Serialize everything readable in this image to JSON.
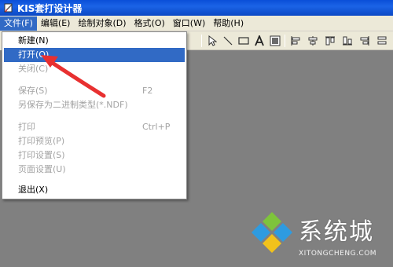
{
  "window": {
    "title": "KIS套打设计器"
  },
  "menubar": {
    "items": [
      {
        "label": "文件(F)"
      },
      {
        "label": "编辑(E)"
      },
      {
        "label": "绘制对象(D)"
      },
      {
        "label": "格式(O)"
      },
      {
        "label": "窗口(W)"
      },
      {
        "label": "帮助(H)"
      }
    ]
  },
  "file_menu": {
    "items": [
      {
        "label": "新建(N)",
        "shortcut": ""
      },
      {
        "label": "打开(O)",
        "shortcut": ""
      },
      {
        "label": "关闭(C)",
        "shortcut": ""
      },
      {
        "label": "保存(S)",
        "shortcut": "F2"
      },
      {
        "label": "另保存为二进制类型(*.NDF)",
        "shortcut": ""
      },
      {
        "label": "打印",
        "shortcut": "Ctrl+P"
      },
      {
        "label": "打印预览(P)",
        "shortcut": ""
      },
      {
        "label": "打印设置(S)",
        "shortcut": ""
      },
      {
        "label": "页面设置(U)",
        "shortcut": ""
      },
      {
        "label": "退出(X)",
        "shortcut": ""
      }
    ]
  },
  "toolbar": {
    "icons": [
      "pointer-icon",
      "line-icon",
      "rectangle-icon",
      "text-icon",
      "image-icon",
      "align-left-icon",
      "align-center-icon",
      "align-top-icon",
      "align-bottom-icon",
      "align-right-icon"
    ]
  },
  "watermark": {
    "text": "系统城",
    "subtext": "XITONGCHENG.COM"
  },
  "colors": {
    "titlebar": "#0a4fd8",
    "menu_highlight": "#316ac5",
    "workspace": "#808080",
    "arrow": "#e83030"
  }
}
